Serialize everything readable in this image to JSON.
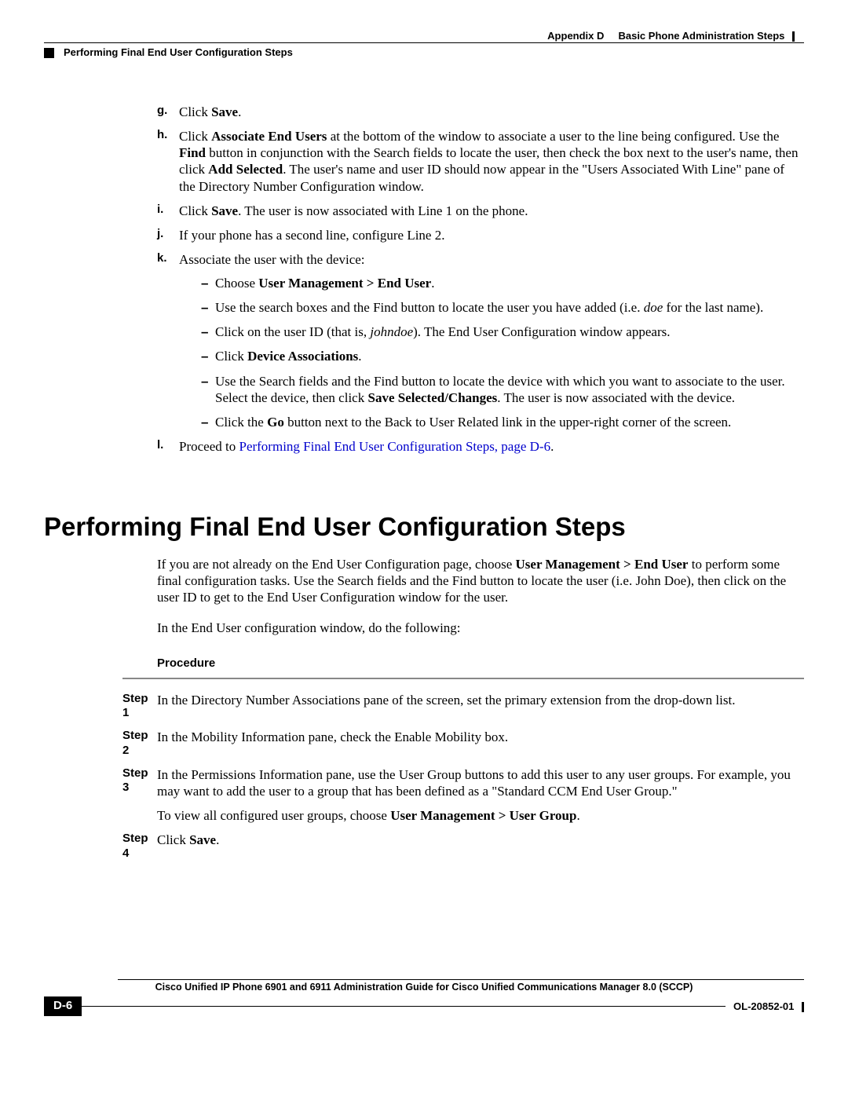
{
  "header": {
    "appendix_label": "Appendix D",
    "appendix_title": "Basic Phone Administration Steps",
    "section_running": "Performing Final End User Configuration Steps"
  },
  "list_g": {
    "marker": "g.",
    "pre": "Click ",
    "bold": "Save",
    "post": "."
  },
  "list_h": {
    "marker": "h.",
    "p1a": "Click ",
    "p1b": "Associate End Users",
    "p1c": " at the bottom of the window to associate a user to the line being configured. Use the ",
    "p1d": "Find",
    "p1e": " button in conjunction with the Search fields to locate the user, then check the box next to the user's name, then click ",
    "p1f": "Add Selected",
    "p1g": ". The user's name and user ID should now appear in the \"Users Associated With Line\" pane of the Directory Number Configuration window."
  },
  "list_i": {
    "marker": "i.",
    "pre": "Click ",
    "bold": "Save",
    "post": ". The user is now associated with Line 1 on the phone."
  },
  "list_j": {
    "marker": "j.",
    "text": "If your phone has a second line, configure Line 2."
  },
  "list_k": {
    "marker": "k.",
    "lead": "Associate the user with the device:",
    "s1a": "Choose ",
    "s1b": "User Management > End User",
    "s1c": ".",
    "s2a": "Use the search boxes and the Find button to locate the user you have added (i.e. ",
    "s2b": "doe",
    "s2c": " for the last name).",
    "s3a": "Click on the user ID (that is, ",
    "s3b": "johndoe",
    "s3c": "). The End User Configuration window appears.",
    "s4a": "Click ",
    "s4b": "Device Associations",
    "s4c": ".",
    "s5a": "Use the Search fields and the Find button to locate the device with which you want to associate to the user. Select the device, then click ",
    "s5b": "Save Selected/Changes",
    "s5c": ". The user is now associated with the device.",
    "s6a": "Click the ",
    "s6b": "Go",
    "s6c": " button next to the Back to User Related link in the upper-right corner of the screen."
  },
  "list_l": {
    "marker": "l.",
    "pre": "Proceed to ",
    "link": "Performing Final End User Configuration Steps, page D-6",
    "post": "."
  },
  "section_heading": "Performing Final End User Configuration Steps",
  "intro": {
    "p1a": "If you are not already on the End User Configuration page, choose ",
    "p1b": "User Management > End User",
    "p1c": " to perform some final configuration tasks. Use the Search fields and the Find button to locate the user (i.e. John Doe), then click on the user ID to get to the End User Configuration window for the user.",
    "p2": "In the End User configuration window, do the following:"
  },
  "procedure_label": "Procedure",
  "steps": {
    "s1": {
      "label": "Step 1",
      "text": "In the Directory Number Associations pane of the screen, set the primary extension from the drop-down list."
    },
    "s2": {
      "label": "Step 2",
      "text": "In the Mobility Information pane, check the Enable Mobility box."
    },
    "s3": {
      "label": "Step 3",
      "p1": "In the Permissions Information pane, use the User Group buttons to add this user to any user groups. For example, you may want to add the user to a group that has been defined as a \"Standard CCM End User Group.\"",
      "p2a": "To view all configured user groups, choose ",
      "p2b": "User Management > User Group",
      "p2c": "."
    },
    "s4": {
      "label": "Step 4",
      "pre": "Click ",
      "bold": "Save",
      "post": "."
    }
  },
  "footer": {
    "book_title": "Cisco Unified IP Phone 6901 and 6911 Administration Guide for Cisco Unified Communications Manager 8.0 (SCCP)",
    "page_num": "D-6",
    "doc_id": "OL-20852-01"
  }
}
